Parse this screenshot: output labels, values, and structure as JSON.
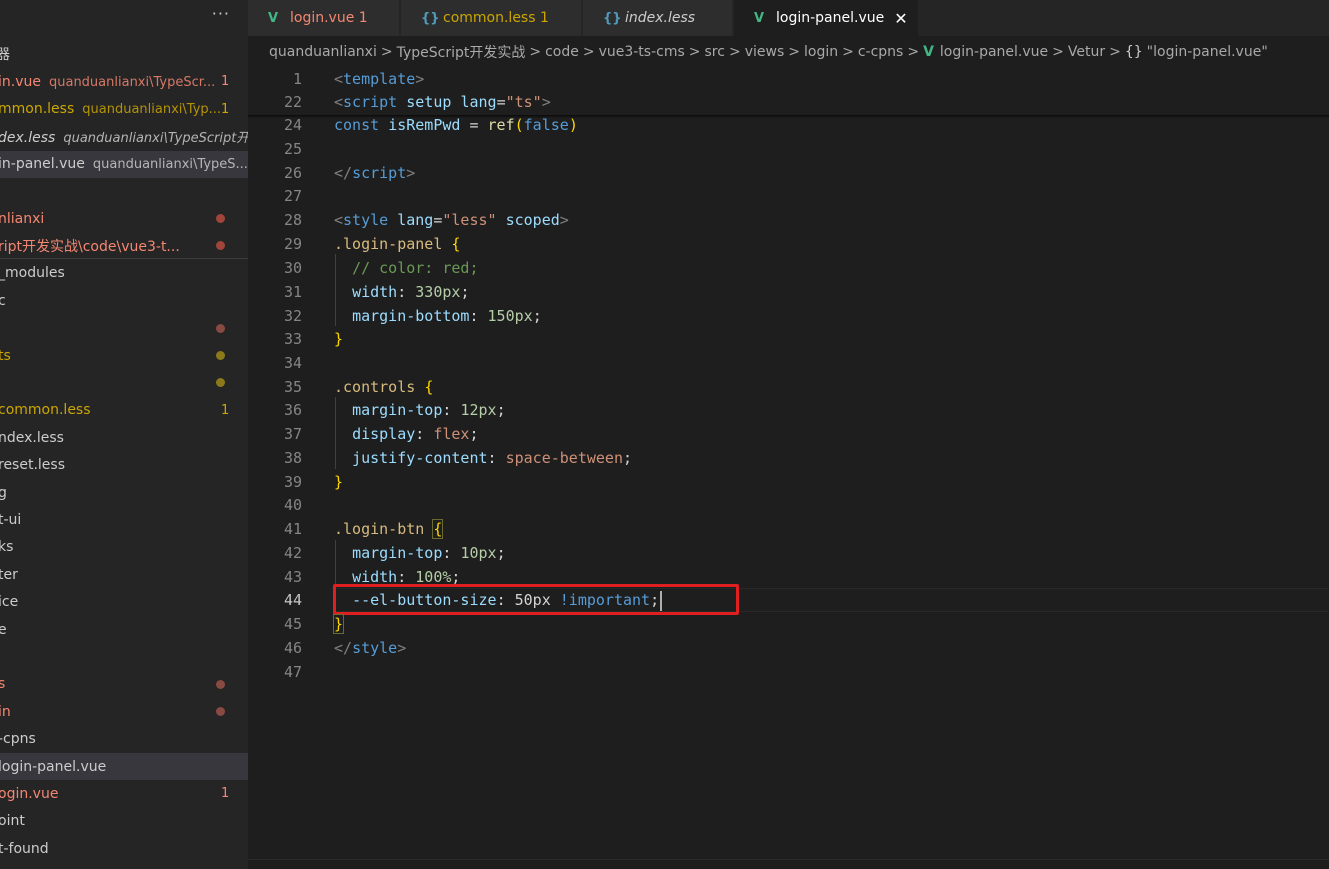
{
  "sidebar": {
    "more_label": "···",
    "open_editors_title": "器",
    "open_editors": [
      {
        "name": "in.vue",
        "desc": "quanduanlianxi\\TypeScr...",
        "badge": "1",
        "color": "red"
      },
      {
        "name": "mmon.less",
        "desc": "quanduanlianxi\\Typ...",
        "badge": "1",
        "color": "yel"
      },
      {
        "name": "dex.less",
        "desc": "quanduanlianxi\\TypeScript开...",
        "badge": "",
        "color": "white",
        "italic": true
      },
      {
        "name": "in-panel.vue",
        "desc": "quanduanlianxi\\TypeS...",
        "badge": "",
        "color": "white",
        "selected": true
      }
    ],
    "tree": [
      {
        "label": "nlianxi",
        "color": "red",
        "dot": "#a1453a"
      },
      {
        "label": "ript开发实战\\code\\vue3-t...",
        "color": "red",
        "dot": "#a1453a"
      },
      {
        "label": "_modules",
        "color": "white"
      },
      {
        "label": "c",
        "color": "white"
      },
      {
        "label": "",
        "color": "white",
        "dot": "#8a4a44"
      },
      {
        "label": "ts",
        "color": "yel",
        "dot": "#8c7a1a"
      },
      {
        "label": "",
        "color": "white",
        "dot": "#8c7a1a"
      },
      {
        "label": "common.less",
        "color": "yel",
        "badge": "1"
      },
      {
        "label": "ndex.less",
        "color": "white"
      },
      {
        "label": "reset.less",
        "color": "white"
      },
      {
        "label": "g",
        "color": "white"
      },
      {
        "label": "t-ui",
        "color": "white"
      },
      {
        "label": "ks",
        "color": "white"
      },
      {
        "label": "ter",
        "color": "white"
      },
      {
        "label": "ice",
        "color": "white"
      },
      {
        "label": "e",
        "color": "white"
      },
      {
        "label": "",
        "color": "white"
      },
      {
        "label": "s",
        "color": "red",
        "dot": "#8a4a44"
      },
      {
        "label": "in",
        "color": "red",
        "dot": "#8a4a44"
      },
      {
        "label": "-cpns",
        "color": "white"
      },
      {
        "label": "login-panel.vue",
        "color": "white",
        "selected": true
      },
      {
        "label": "ogin.vue",
        "color": "red",
        "badge": "1"
      },
      {
        "label": "oint",
        "color": "white"
      },
      {
        "label": "t-found",
        "color": "white"
      }
    ]
  },
  "tabs": [
    {
      "icon": "vue",
      "label": "login.vue",
      "badge": "1",
      "color": "red"
    },
    {
      "icon": "brace",
      "label": "common.less",
      "badge": "1",
      "color": "yel"
    },
    {
      "icon": "brace",
      "label": "index.less",
      "badge": "",
      "color": "white",
      "italic": true
    },
    {
      "icon": "vue",
      "label": "login-panel.vue",
      "badge": "",
      "color": "white",
      "active": true,
      "close": "✕"
    }
  ],
  "breadcrumb": {
    "parts": [
      "quanduanlianxi",
      "TypeScript开发实战",
      "code",
      "vue3-ts-cms",
      "src",
      "views",
      "login",
      "c-cpns"
    ],
    "file": "login-panel.vue",
    "vetur": "Vetur",
    "symbol": "\"login-panel.vue\""
  },
  "editor": {
    "current_line": 44,
    "lines": [
      {
        "n": "1",
        "html": "<span class=\"tk-tag\">&lt;</span><span class=\"tk-tname\">template</span><span class=\"tk-tag\">&gt;</span>"
      },
      {
        "n": "22",
        "html": "<span class=\"tk-tag\">&lt;</span><span class=\"tk-tname\">script</span> <span class=\"tk-attr\">setup</span> <span class=\"tk-attr\">lang</span><span class=\"tk-plain\">=</span><span class=\"tk-str\">\"ts\"</span><span class=\"tk-tag\">&gt;</span>"
      },
      {
        "n": "24",
        "html": "<span class=\"tk-kw\">const</span> <span class=\"tk-var\">isRemPwd</span> <span class=\"tk-plain\">=</span> <span class=\"tk-fn\">ref</span><span class=\"tk-br\">(</span><span class=\"tk-kw\">false</span><span class=\"tk-br\">)</span>"
      },
      {
        "n": "25",
        "html": ""
      },
      {
        "n": "26",
        "html": "<span class=\"tk-tag\">&lt;/</span><span class=\"tk-tname\">script</span><span class=\"tk-tag\">&gt;</span>"
      },
      {
        "n": "27",
        "html": ""
      },
      {
        "n": "28",
        "html": "<span class=\"tk-tag\">&lt;</span><span class=\"tk-tname\">style</span> <span class=\"tk-attr\">lang</span><span class=\"tk-plain\">=</span><span class=\"tk-str\">\"less\"</span> <span class=\"tk-attr\">scoped</span><span class=\"tk-tag\">&gt;</span>"
      },
      {
        "n": "29",
        "html": "<span class=\"tk-sel\">.login-panel</span> <span class=\"tk-br\">{</span>"
      },
      {
        "n": "30",
        "html": "  <span class=\"tk-cmt\">// color: red;</span>"
      },
      {
        "n": "31",
        "html": "  <span class=\"tk-prop\">width</span><span class=\"tk-plain\">: </span><span class=\"tk-num\">330px</span><span class=\"tk-plain\">;</span>"
      },
      {
        "n": "32",
        "html": "  <span class=\"tk-prop\">margin-bottom</span><span class=\"tk-plain\">: </span><span class=\"tk-num\">150px</span><span class=\"tk-plain\">;</span>"
      },
      {
        "n": "33",
        "html": "<span class=\"tk-br\">}</span>"
      },
      {
        "n": "34",
        "html": ""
      },
      {
        "n": "35",
        "html": "<span class=\"tk-sel\">.controls</span> <span class=\"tk-br\">{</span>"
      },
      {
        "n": "36",
        "html": "  <span class=\"tk-prop\">margin-top</span><span class=\"tk-plain\">: </span><span class=\"tk-num\">12px</span><span class=\"tk-plain\">;</span>"
      },
      {
        "n": "37",
        "html": "  <span class=\"tk-prop\">display</span><span class=\"tk-plain\">: </span><span class=\"tk-val\">flex</span><span class=\"tk-plain\">;</span>"
      },
      {
        "n": "38",
        "html": "  <span class=\"tk-prop\">justify-content</span><span class=\"tk-plain\">: </span><span class=\"tk-val\">space-between</span><span class=\"tk-plain\">;</span>"
      },
      {
        "n": "39",
        "html": "<span class=\"tk-br\">}</span>"
      },
      {
        "n": "40",
        "html": ""
      },
      {
        "n": "41",
        "html": "<span class=\"tk-sel\">.login-btn</span> <span class=\"tk-br\" style=\"outline:1px solid #6a6a30\">{</span>"
      },
      {
        "n": "42",
        "html": "  <span class=\"tk-prop\">margin-top</span><span class=\"tk-plain\">: </span><span class=\"tk-num\">10px</span><span class=\"tk-plain\">;</span>"
      },
      {
        "n": "43",
        "html": "  <span class=\"tk-prop\">width</span><span class=\"tk-plain\">: </span><span class=\"tk-num\">100%</span><span class=\"tk-plain\">;</span>"
      },
      {
        "n": "44",
        "html": "  <span class=\"tk-prop\">--el-button-size</span><span class=\"tk-plain\">: 50px </span><span class=\"tk-kw\">!important</span><span class=\"tk-plain\">;</span><span class=\"cursor\"></span>"
      },
      {
        "n": "45",
        "html": "<span class=\"tk-br\" style=\"outline:1px solid #6a6a30\">}</span>"
      },
      {
        "n": "46",
        "html": "<span class=\"tk-tag\">&lt;/</span><span class=\"tk-tname\">style</span><span class=\"tk-tag\">&gt;</span>"
      },
      {
        "n": "47",
        "html": ""
      }
    ]
  }
}
